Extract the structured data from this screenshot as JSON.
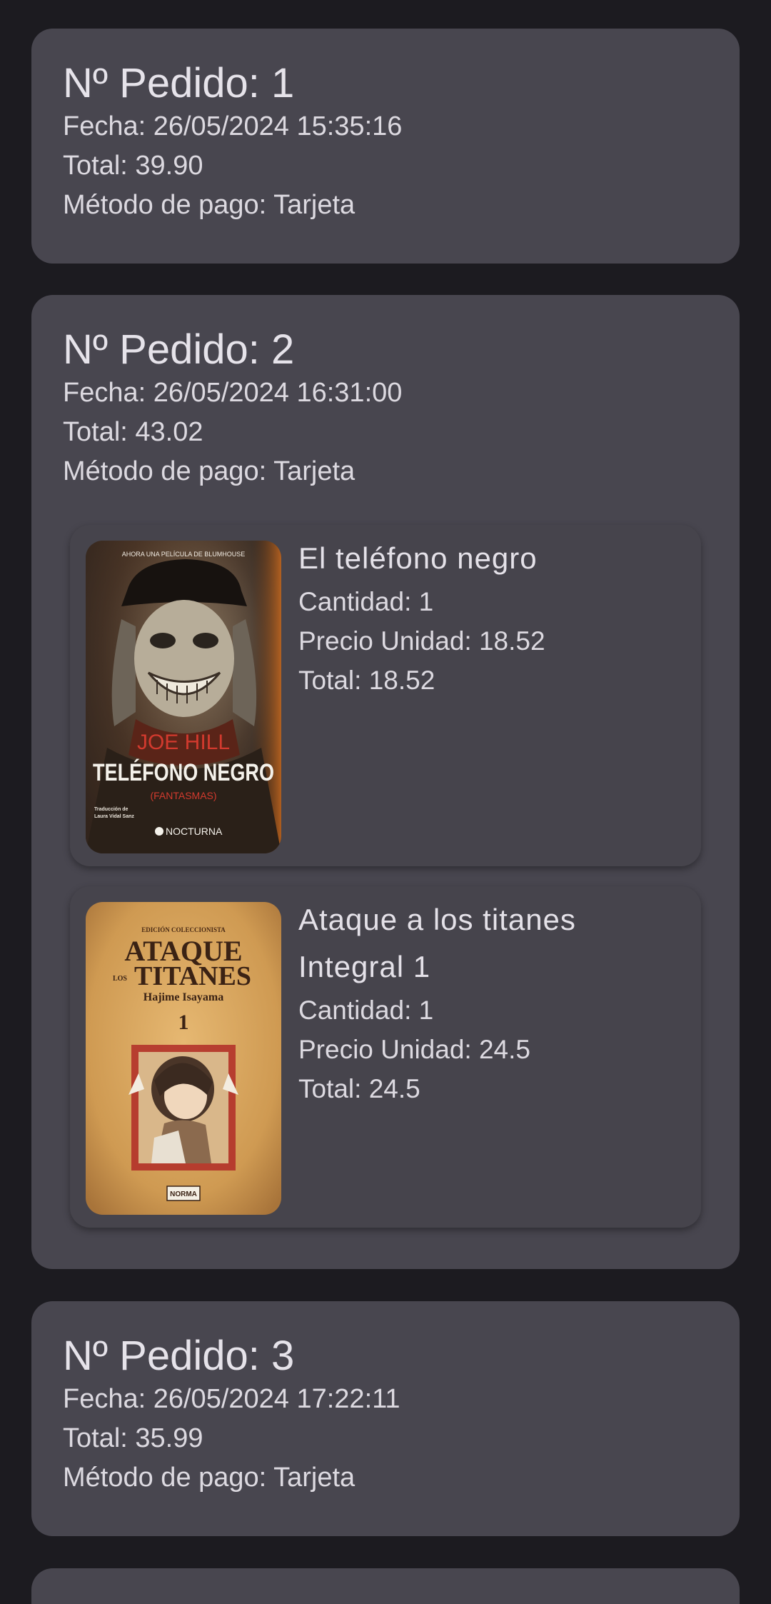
{
  "orders": [
    {
      "title": "Nº Pedido: 1",
      "date": "Fecha: 26/05/2024 15:35:16",
      "total": "Total: 39.90",
      "payment": "Método de pago: Tarjeta"
    },
    {
      "title": "Nº Pedido: 2",
      "date": "Fecha: 26/05/2024 16:31:00",
      "total": "Total: 43.02",
      "payment": "Método de pago: Tarjeta",
      "items": [
        {
          "title": "El teléfono negro",
          "quantity": "Cantidad: 1",
          "unit_price": "Precio Unidad: 18.52",
          "total": "Total: 18.52",
          "cover": {
            "top_text": "AHORA UNA PELÍCULA DE BLUMHOUSE",
            "author": "JOE HILL",
            "title": "TELÉFONO NEGRO",
            "subtitle": "(FANTASMAS)",
            "translator_line1": "Traducción de",
            "translator_line2": "Laura Vidal Sanz",
            "publisher": "NOCTURNA"
          }
        },
        {
          "title": "Ataque a los titanes Integral 1",
          "quantity": "Cantidad: 1",
          "unit_price": "Precio Unidad: 24.5",
          "total": "Total: 24.5",
          "cover": {
            "edition": "EDICIÓN COLECCIONISTA",
            "title_line1": "ATAQUE",
            "title_small": "LOS",
            "title_line2": "TITANES",
            "author": "Hajime Isayama",
            "volume": "1",
            "publisher": "NORMA"
          }
        }
      ]
    },
    {
      "title": "Nº Pedido: 3",
      "date": "Fecha: 26/05/2024 17:22:11",
      "total": "Total: 35.99",
      "payment": "Método de pago: Tarjeta"
    }
  ],
  "colors": {
    "background": "#1c1b20",
    "card": "#48464f",
    "text": "#e4e1e8"
  }
}
